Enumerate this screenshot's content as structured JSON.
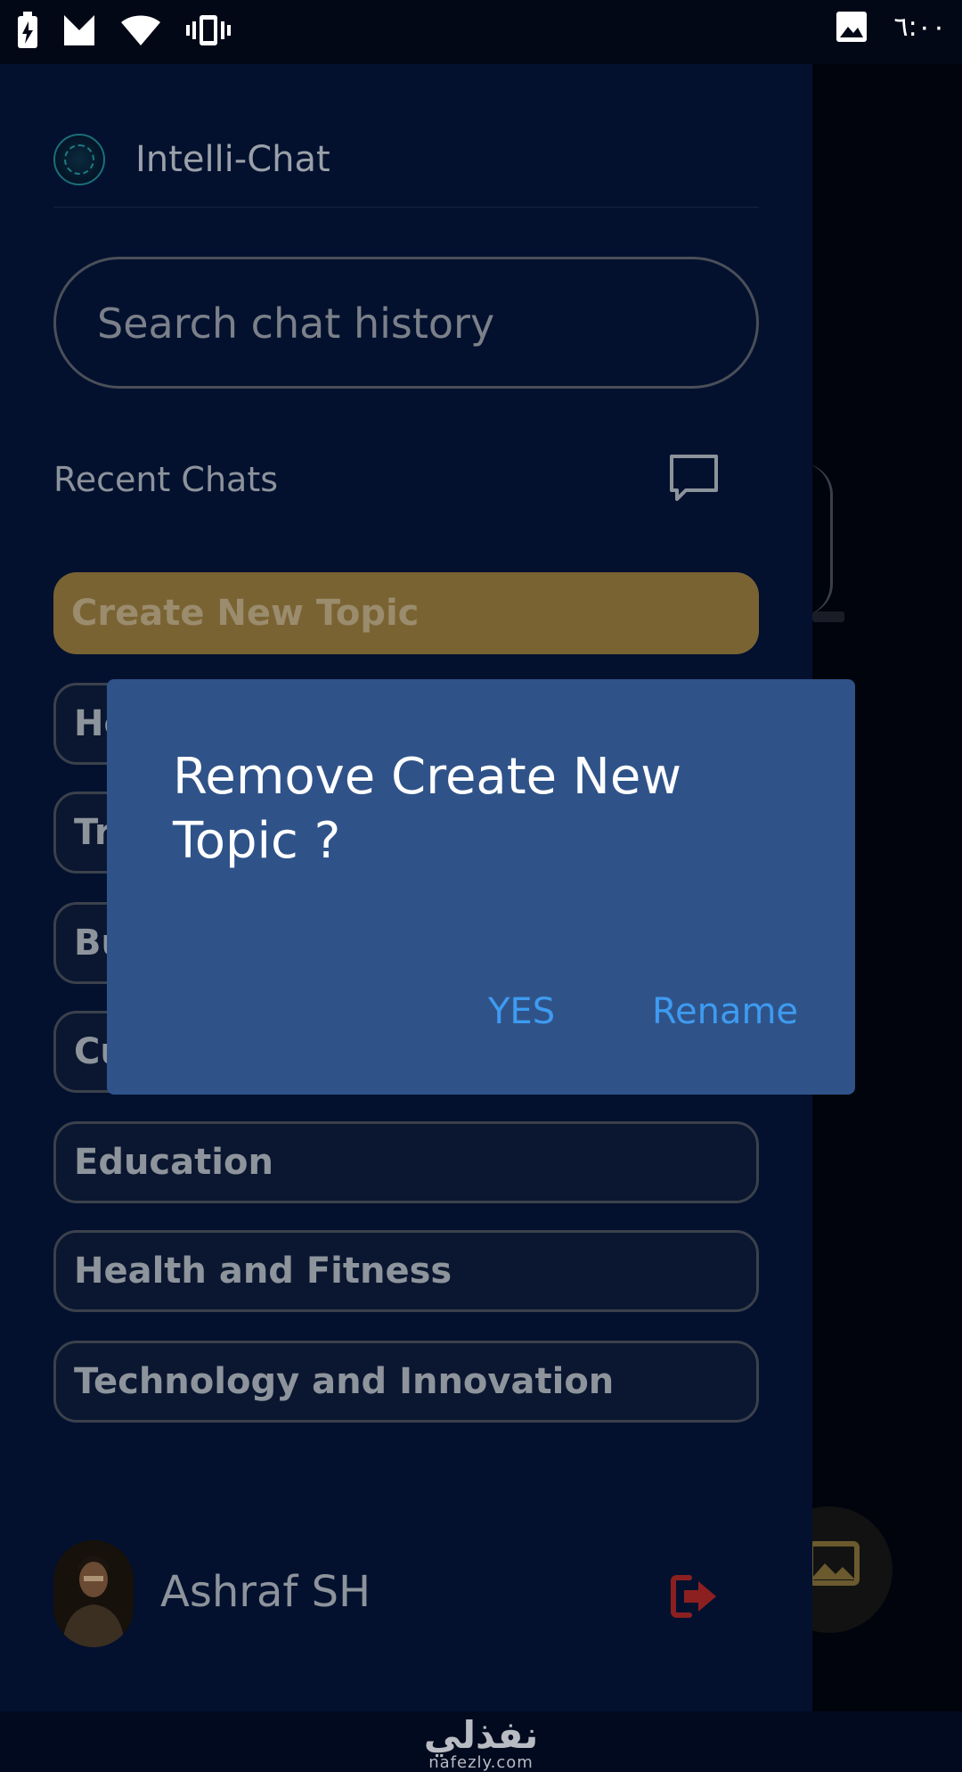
{
  "status_bar": {
    "time": "٦:٠٠"
  },
  "drawer": {
    "app_title": "Intelli-Chat",
    "search": {
      "placeholder": "Search chat history"
    },
    "recent_label": "Recent Chats",
    "topics": [
      {
        "label": "Create New Topic",
        "active": true
      },
      {
        "label": "Ho"
      },
      {
        "label": "Tr"
      },
      {
        "label": "Bu"
      },
      {
        "label": "Cu"
      },
      {
        "label": "Education"
      },
      {
        "label": "Health and Fitness"
      },
      {
        "label": "Technology and Innovation"
      }
    ],
    "user_name": "Ashraf SH"
  },
  "dialog": {
    "title": "Remove Create New Topic ?",
    "yes_label": "YES",
    "rename_label": "Rename"
  },
  "watermark": {
    "arabic": "نفذلي",
    "domain": "nafezly.com"
  },
  "colors": {
    "drawer_bg": "#03112f",
    "dialog_bg": "#2f5389",
    "dialog_button": "#3e9bf0",
    "active_topic": "#7a6333",
    "logout": "#8c2020"
  }
}
